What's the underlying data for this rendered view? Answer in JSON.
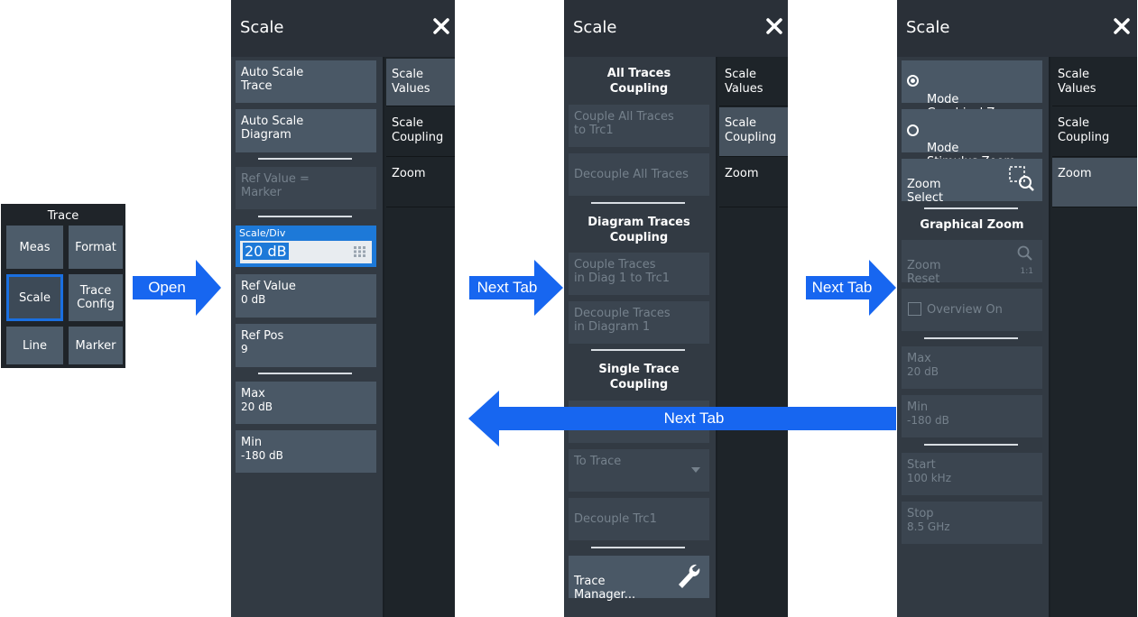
{
  "trace_menu": {
    "title": "Trace",
    "buttons": [
      "Meas",
      "Format",
      "Scale",
      "Trace\nConfig",
      "Line",
      "Marker"
    ]
  },
  "arrows": {
    "open": "Open",
    "next_tab_1": "Next Tab",
    "next_tab_2": "Next Tab",
    "next_tab_back": "Next Tab"
  },
  "panel_values": {
    "title": "Scale",
    "tabs": [
      "Scale\nValues",
      "Scale\nCoupling",
      "Zoom"
    ],
    "auto_scale_trace": "Auto Scale\nTrace",
    "auto_scale_diagram": "Auto Scale\nDiagram",
    "ref_value_marker": "Ref Value =\nMarker",
    "scale_div_label": "Scale/Div",
    "scale_div_value": "20 dB",
    "ref_value_label": "Ref Value",
    "ref_value_value": "0 dB",
    "ref_pos_label": "Ref Pos",
    "ref_pos_value": "9",
    "max_label": "Max",
    "max_value": "20 dB",
    "min_label": "Min",
    "min_value": "-180 dB"
  },
  "panel_coupling": {
    "title": "Scale",
    "tabs": [
      "Scale\nValues",
      "Scale\nCoupling",
      "Zoom"
    ],
    "all_traces_heading": "All Traces\nCoupling",
    "couple_all": "Couple All Traces\nto Trc1",
    "decouple_all": "Decouple All Traces",
    "diagram_heading": "Diagram Traces\nCoupling",
    "couple_diag": "Couple Traces\nin Diag 1 to Trc1",
    "decouple_diag": "Decouple Traces\nin Diagram 1",
    "single_heading": "Single Trace\nCoupling",
    "to_trace": "To Trace",
    "decouple_trc1": "Decouple Trc1",
    "trace_manager": "Trace\nManager..."
  },
  "panel_zoom": {
    "title": "Scale",
    "tabs": [
      "Scale\nValues",
      "Scale\nCoupling",
      "Zoom"
    ],
    "mode_graphical": "Mode\nGraphical Zoom",
    "mode_stimulus": "Mode\nStimulus Zoom",
    "zoom_select": "Zoom\nSelect",
    "graphical_heading": "Graphical Zoom",
    "zoom_reset": "Zoom\nReset",
    "zoom_reset_ratio": "1:1",
    "overview": "Overview On",
    "max_label": "Max",
    "max_value": "20 dB",
    "min_label": "Min",
    "min_value": "-180 dB",
    "start_label": "Start",
    "start_value": "100 kHz",
    "stop_label": "Stop",
    "stop_value": "8.5 GHz"
  },
  "colors": {
    "accent": "#1a6fe0",
    "arrow": "#1766f0",
    "panel_bg": "#2a3038",
    "button": "#4a5866"
  }
}
